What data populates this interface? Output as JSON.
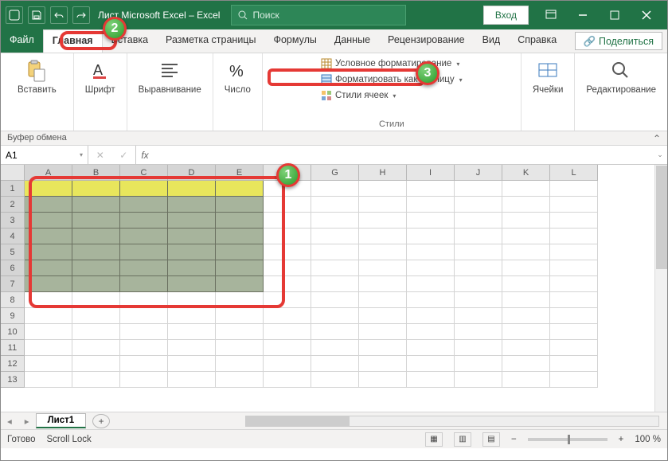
{
  "title": "Лист Microsoft Excel  –  Excel",
  "search_placeholder": "Поиск",
  "login_label": "Вход",
  "tabs": {
    "file": "Файл",
    "home": "Главная",
    "insert": "Вставка",
    "layout": "Разметка страницы",
    "formulas": "Формулы",
    "data": "Данные",
    "review": "Рецензирование",
    "view": "Вид",
    "help": "Справка"
  },
  "share_label": "Поделиться",
  "groups": {
    "clipboard": {
      "paste": "Вставить",
      "label": "Буфер обмена"
    },
    "font": {
      "btn": "Шрифт",
      "label": ""
    },
    "align": {
      "btn": "Выравнивание",
      "label": ""
    },
    "number": {
      "btn": "Число",
      "label": ""
    },
    "styles": {
      "cond": "Условное форматирование",
      "table": "Форматировать как таблицу",
      "cell": "Стили ячеек",
      "label": "Стили"
    },
    "cells": {
      "btn": "Ячейки",
      "label": ""
    },
    "editing": {
      "btn": "Редактирование",
      "label": ""
    }
  },
  "namebox_label": "Буфер обмена",
  "cell_ref": "A1",
  "columns": [
    "A",
    "B",
    "C",
    "D",
    "E",
    "F",
    "G",
    "H",
    "I",
    "J",
    "K",
    "L"
  ],
  "rows": [
    "1",
    "2",
    "3",
    "4",
    "5",
    "6",
    "7",
    "8",
    "9",
    "10",
    "11",
    "12",
    "13"
  ],
  "selected_cols": 5,
  "selected_rows": 7,
  "sheet_name": "Лист1",
  "status_ready": "Готово",
  "status_scroll": "Scroll Lock",
  "zoom_text": "100 %",
  "accent": "#217346",
  "callout_accent": "#e53935"
}
